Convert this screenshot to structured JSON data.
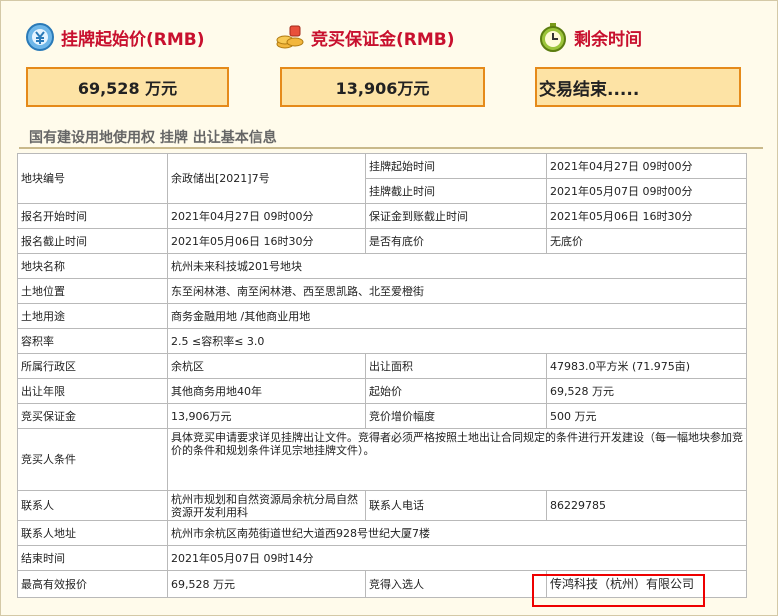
{
  "header": {
    "price_label": "挂牌起始价(RMB)",
    "deposit_label": "竞买保证金(RMB)",
    "time_label": "剩余时间",
    "price_value": "69,528 万元",
    "deposit_value": "13,906万元",
    "time_value": "交易结束....."
  },
  "section_title": "国有建设用地使用权 挂牌 出让基本信息",
  "rows": {
    "plot_no": {
      "k": "地块编号",
      "v": "余政储出[2021]7号"
    },
    "list_start": {
      "k": "挂牌起始时间",
      "v": "2021年04月27日 09时00分"
    },
    "list_end": {
      "k": "挂牌截止时间",
      "v": "2021年05月07日 09时00分"
    },
    "reg_start": {
      "k": "报名开始时间",
      "v": "2021年04月27日 09时00分"
    },
    "deposit_deadline": {
      "k": "保证金到账截止时间",
      "v": "2021年05月06日 16时30分"
    },
    "reg_end": {
      "k": "报名截止时间",
      "v": "2021年05月06日 16时30分"
    },
    "reserve": {
      "k": "是否有底价",
      "v": "无底价"
    },
    "plot_name": {
      "k": "地块名称",
      "v": "杭州未来科技城201号地块"
    },
    "location": {
      "k": "土地位置",
      "v": "东至闲林港、南至闲林港、西至思凯路、北至爱橙街"
    },
    "usage": {
      "k": "土地用途",
      "v": "商务金融用地 /其他商业用地"
    },
    "far": {
      "k": "容积率",
      "v": "2.5 ≤容积率≤ 3.0"
    },
    "district": {
      "k": "所属行政区",
      "v": "余杭区"
    },
    "area": {
      "k": "出让面积",
      "v": "47983.0平方米 (71.975亩)"
    },
    "term": {
      "k": "出让年限",
      "v": "其他商务用地40年"
    },
    "start_price": {
      "k": "起始价",
      "v": "69,528 万元"
    },
    "bid_deposit": {
      "k": "竞买保证金",
      "v": "13,906万元"
    },
    "increment": {
      "k": "竞价增价幅度",
      "v": "500 万元"
    },
    "conditions": {
      "k": "竞买人条件",
      "v": "具体竞买申请要求详见挂牌出让文件。竞得者必须严格按照土地出让合同规定的条件进行开发建设（每一幅地块参加竞价的条件和规划条件详见宗地挂牌文件）。"
    },
    "contact": {
      "k": "联系人",
      "v": "杭州市规划和自然资源局余杭分局自然资源开发利用科"
    },
    "phone": {
      "k": "联系人电话",
      "v": "86229785"
    },
    "address": {
      "k": "联系人地址",
      "v": "杭州市余杭区南苑街道世纪大道西928号世纪大厦7楼"
    },
    "end_time": {
      "k": "结束时间",
      "v": "2021年05月07日 09时14分"
    },
    "top_bid": {
      "k": "最高有效报价",
      "v": "69,528 万元"
    },
    "winner": {
      "k": "竞得入选人",
      "v": "传鸿科技（杭州）有限公司"
    }
  },
  "icons": {
    "price": "money-icon",
    "deposit": "coins-icon",
    "time": "clock-icon"
  },
  "colors": {
    "accent": "#c8102e",
    "box_border": "#e58a1a",
    "box_fill": "#fde3a5",
    "highlight": "#e00000"
  }
}
